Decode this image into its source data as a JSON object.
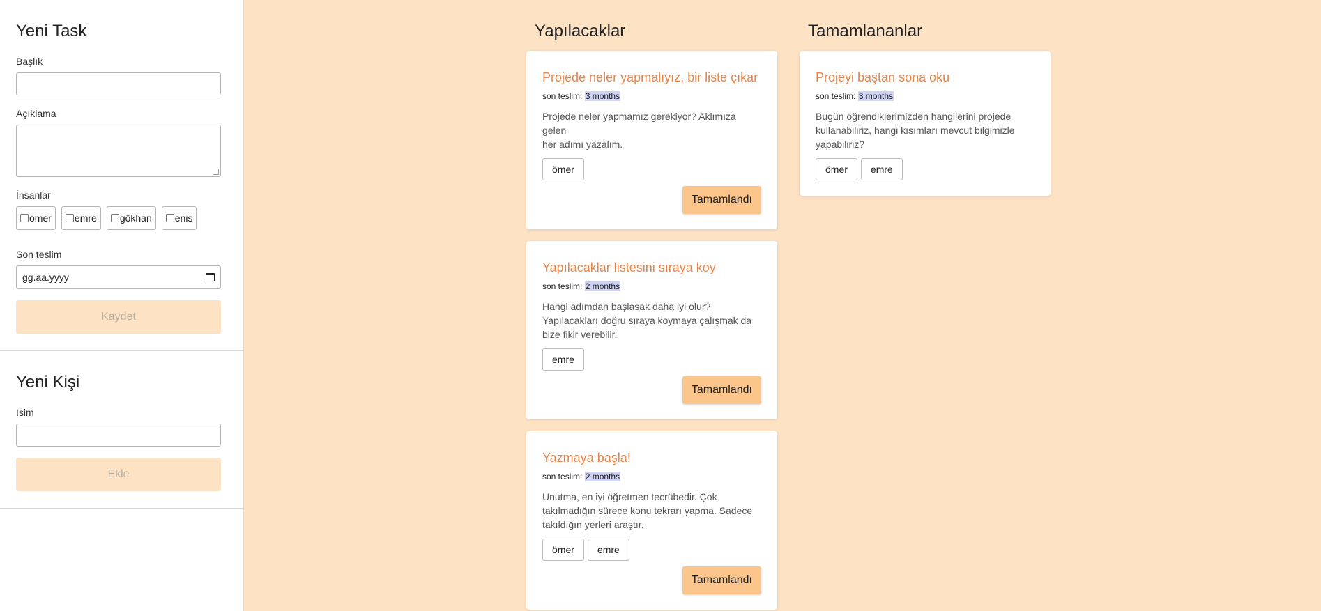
{
  "new_task": {
    "heading": "Yeni Task",
    "title_label": "Başlık",
    "title_value": "",
    "desc_label": "Açıklama",
    "desc_value": "",
    "people_label": "İnsanlar",
    "people": [
      "ömer",
      "emre",
      "gökhan",
      "enis"
    ],
    "deadline_label": "Son teslim",
    "deadline_placeholder": "gg.aa.yyyy",
    "save_label": "Kaydet"
  },
  "new_person": {
    "heading": "Yeni Kişi",
    "name_label": "İsim",
    "name_value": "",
    "add_label": "Ekle"
  },
  "todo": {
    "heading": "Yapılacaklar",
    "cards": [
      {
        "title": "Projede neler yapmalıyız, bir liste çıkar",
        "deadline_prefix": "son teslim:",
        "deadline_value": "3 months",
        "desc_lines": [
          "Projede neler yapmamız gerekiyor? Aklımıza gelen",
          "her adımı yazalım."
        ],
        "assignees": [
          "ömer"
        ],
        "done_label": "Tamamlandı"
      },
      {
        "title": "Yapılacaklar listesini sıraya koy",
        "deadline_prefix": "son teslim:",
        "deadline_value": "2 months",
        "desc_lines": [
          "Hangi adımdan başlasak daha iyi olur?",
          "Yapılacakları doğru sıraya koymaya çalışmak da",
          "bize fikir verebilir."
        ],
        "assignees": [
          "emre"
        ],
        "done_label": "Tamamlandı"
      },
      {
        "title": "Yazmaya başla!",
        "deadline_prefix": "son teslim:",
        "deadline_value": "2 months",
        "desc_lines": [
          "Unutma, en iyi öğretmen tecrübedir. Çok",
          "takılmadığın sürece konu tekrarı yapma. Sadece",
          "takıldığın yerleri araştır."
        ],
        "assignees": [
          "ömer",
          "emre"
        ],
        "done_label": "Tamamlandı"
      }
    ]
  },
  "done": {
    "heading": "Tamamlananlar",
    "cards": [
      {
        "title": "Projeyi baştan sona oku",
        "deadline_prefix": "son teslim:",
        "deadline_value": "3 months",
        "desc_lines": [
          "Bugün öğrendiklerimizden hangilerini projede",
          "kullanabiliriz, hangi kısımları mevcut bilgimizle",
          "yapabiliriz?"
        ],
        "assignees": [
          "ömer",
          "emre"
        ]
      }
    ]
  }
}
